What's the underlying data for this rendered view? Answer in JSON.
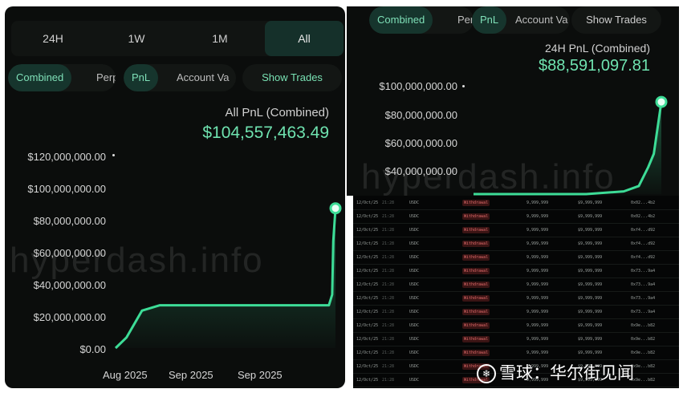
{
  "left": {
    "ranges": [
      {
        "label": "24H",
        "active": false
      },
      {
        "label": "1W",
        "active": false
      },
      {
        "label": "1M",
        "active": false
      },
      {
        "label": "All",
        "active": true
      }
    ],
    "tabs": [
      {
        "label": "Combined",
        "active": true
      },
      {
        "label": "Perp",
        "active": false
      }
    ],
    "modes": [
      {
        "label": "PnL",
        "active": true
      },
      {
        "label": "Account Va",
        "active": false
      }
    ],
    "show_trades": "Show Trades",
    "pnl_label": "All PnL (Combined)",
    "pnl_value": "$104,557,463.49",
    "watermark": "hyperdash.info"
  },
  "right": {
    "tabs": [
      {
        "label": "Combined",
        "active": true
      },
      {
        "label": "Perp",
        "active": false
      }
    ],
    "modes": [
      {
        "label": "PnL",
        "active": true
      },
      {
        "label": "Account Va",
        "active": false
      }
    ],
    "show_trades": "Show Trades",
    "pnl_label": "24H PnL (Combined)",
    "pnl_value": "$88,591,097.81",
    "watermark": "hyperdash.info"
  },
  "chart_data": [
    {
      "type": "area",
      "title": "All PnL (Combined)",
      "y_ticks": [
        "$120,000,000.00",
        "$100,000,000.00",
        "$80,000,000.00",
        "$60,000,000.00",
        "$40,000,000.00",
        "$20,000,000.00",
        "$0.00"
      ],
      "x_ticks": [
        "Aug 2025",
        "Sep 2025",
        "Sep 2025"
      ],
      "ylim": [
        0,
        120000000
      ],
      "series": [
        {
          "x": [
            0,
            0.05,
            0.12,
            0.2,
            0.5,
            0.8,
            0.97,
            0.985,
            0.99,
            1.0
          ],
          "values": [
            0,
            8000000,
            28000000,
            32000000,
            32000000,
            32000000,
            32000000,
            40000000,
            80000000,
            104557463.49
          ]
        }
      ],
      "color": "#3ddc97"
    },
    {
      "type": "area",
      "title": "24H PnL (Combined)",
      "y_ticks": [
        "$100,000,000.00",
        "$80,000,000.00",
        "$60,000,000.00",
        "$40,000,000.00"
      ],
      "ylim": [
        20000000,
        100000000
      ],
      "series": [
        {
          "x": [
            0,
            0.3,
            0.6,
            0.8,
            0.88,
            0.93,
            0.96,
            1.0
          ],
          "values": [
            20000000,
            20000000,
            20000000,
            22000000,
            26000000,
            40000000,
            50000000,
            88591097.81
          ]
        }
      ],
      "color": "#3ddc97"
    }
  ],
  "table": {
    "rows": [
      {
        "date": "12/Oct/25",
        "time": "21:28",
        "asset": "USDC",
        "tag": "Withdrawal",
        "qty": "9,999,999",
        "value": "$9,999,999",
        "addr": "0x02...4b2"
      },
      {
        "date": "12/Oct/25",
        "time": "21:28",
        "asset": "USDC",
        "tag": "Withdrawal",
        "qty": "9,999,999",
        "value": "$9,999,999",
        "addr": "0x02...4b2"
      },
      {
        "date": "12/Oct/25",
        "time": "21:28",
        "asset": "USDC",
        "tag": "Withdrawal",
        "qty": "9,999,999",
        "value": "$9,999,999",
        "addr": "0xf4...d92"
      },
      {
        "date": "12/Oct/25",
        "time": "21:28",
        "asset": "USDC",
        "tag": "Withdrawal",
        "qty": "9,999,999",
        "value": "$9,999,999",
        "addr": "0xf4...d92"
      },
      {
        "date": "12/Oct/25",
        "time": "21:28",
        "asset": "USDC",
        "tag": "Withdrawal",
        "qty": "9,999,999",
        "value": "$9,999,999",
        "addr": "0xf4...d92"
      },
      {
        "date": "12/Oct/25",
        "time": "21:28",
        "asset": "USDC",
        "tag": "Withdrawal",
        "qty": "9,999,999",
        "value": "$9,999,999",
        "addr": "0x73...9a4"
      },
      {
        "date": "12/Oct/25",
        "time": "21:28",
        "asset": "USDC",
        "tag": "Withdrawal",
        "qty": "9,999,999",
        "value": "$9,999,999",
        "addr": "0x73...9a4"
      },
      {
        "date": "12/Oct/25",
        "time": "21:28",
        "asset": "USDC",
        "tag": "Withdrawal",
        "qty": "9,999,999",
        "value": "$9,999,999",
        "addr": "0x73...9a4"
      },
      {
        "date": "12/Oct/25",
        "time": "21:28",
        "asset": "USDC",
        "tag": "Withdrawal",
        "qty": "9,999,999",
        "value": "$9,999,999",
        "addr": "0x73...9a4"
      },
      {
        "date": "12/Oct/25",
        "time": "21:28",
        "asset": "USDC",
        "tag": "Withdrawal",
        "qty": "9,999,999",
        "value": "$9,999,999",
        "addr": "0x9e...b82"
      },
      {
        "date": "12/Oct/25",
        "time": "21:28",
        "asset": "USDC",
        "tag": "Withdrawal",
        "qty": "9,999,999",
        "value": "$9,999,999",
        "addr": "0x9e...b82"
      },
      {
        "date": "12/Oct/25",
        "time": "21:28",
        "asset": "USDC",
        "tag": "Withdrawal",
        "qty": "9,999,999",
        "value": "$9,999,999",
        "addr": "0x9e...b82"
      },
      {
        "date": "12/Oct/25",
        "time": "21:28",
        "asset": "USDC",
        "tag": "Withdrawal",
        "qty": "9,999,999",
        "value": "$9,999,999",
        "addr": "0x9e...b82"
      },
      {
        "date": "12/Oct/25",
        "time": "21:28",
        "asset": "USDC",
        "tag": "Withdrawal",
        "qty": "9,999,999",
        "value": "$9,999,999",
        "addr": "0x9e...b82"
      }
    ]
  },
  "source_badge": {
    "icon": "snowball-icon",
    "text": "雪球：华尔街见闻"
  }
}
